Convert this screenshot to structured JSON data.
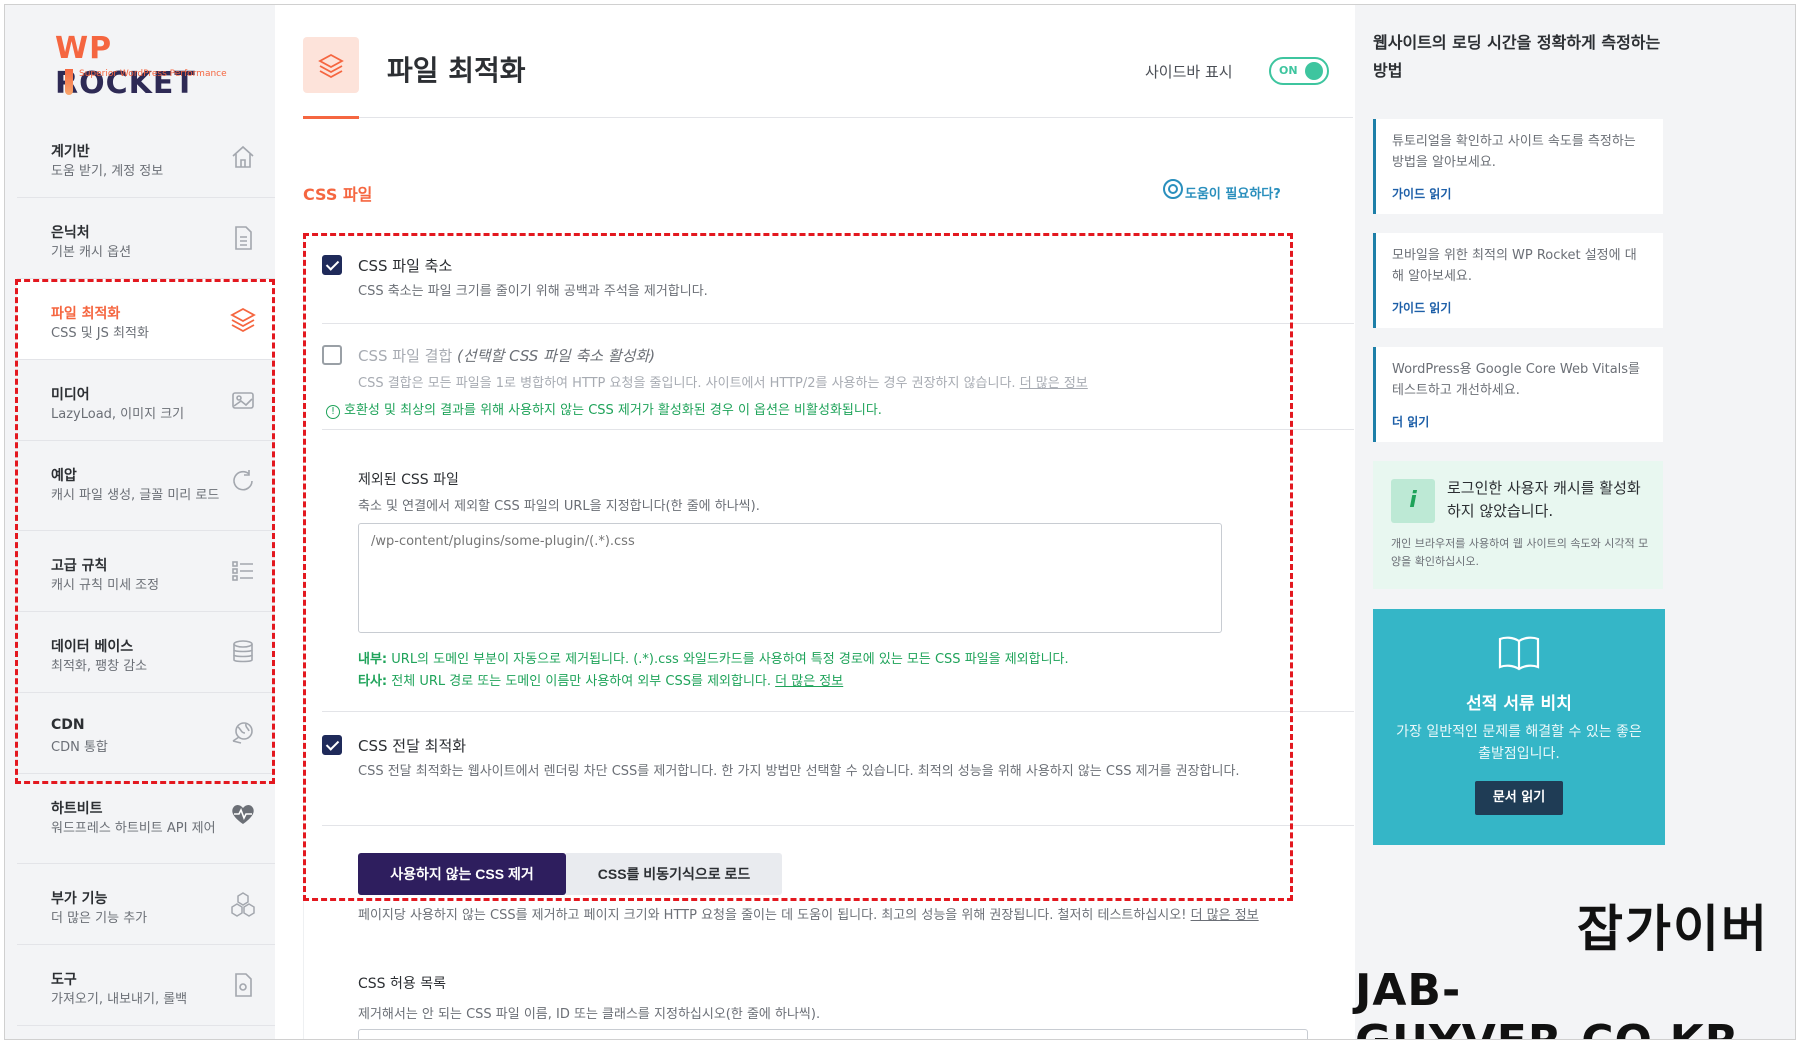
{
  "logo": {
    "brand_a": "WP",
    "brand_b": "ROCKET",
    "tagline": "Superior WordPress Performance"
  },
  "sidebar": {
    "items": [
      {
        "title": "계기반",
        "subtitle": "도움 받기, 계정 정보",
        "icon": "home-icon"
      },
      {
        "title": "은닉처",
        "subtitle": "기본 캐시 옵션",
        "icon": "file-icon"
      },
      {
        "title": "파일 최적화",
        "subtitle": "CSS 및 JS 최적화",
        "icon": "layers-icon",
        "active": true
      },
      {
        "title": "미디어",
        "subtitle": "LazyLoad, 이미지 크기",
        "icon": "image-icon"
      },
      {
        "title": "예압",
        "subtitle": "캐시 파일 생성, 글꼴 미리 로드",
        "icon": "refresh-icon"
      },
      {
        "title": "고급 규칙",
        "subtitle": "캐시 규칙 미세 조정",
        "icon": "list-icon"
      },
      {
        "title": "데이터 베이스",
        "subtitle": "최적화, 팽창 감소",
        "icon": "database-icon"
      },
      {
        "title": "CDN",
        "subtitle": "CDN 통합",
        "icon": "globe-icon"
      },
      {
        "title": "하트비트",
        "subtitle": "워드프레스 하트비트 API 제어",
        "icon": "heart-icon"
      },
      {
        "title": "부가 기능",
        "subtitle": "더 많은 기능 추가",
        "icon": "cubes-icon"
      },
      {
        "title": "도구",
        "subtitle": "가져오기, 내보내기, 롤백",
        "icon": "tool-icon"
      }
    ]
  },
  "header": {
    "title": "파일 최적화",
    "sidebar_toggle_label": "사이드바 표시",
    "toggle_state": "ON"
  },
  "section": {
    "title": "CSS 파일",
    "help": "도움이 필요하다?"
  },
  "options": {
    "minify": {
      "title": "CSS 파일 축소",
      "desc": "CSS 축소는 파일 크기를 줄이기 위해 공백과 주석을 제거합니다.",
      "checked": true
    },
    "combine": {
      "title": "CSS 파일 결합",
      "title_note": "(선택할 CSS 파일 축소 활성화)",
      "desc": "CSS 결합은 모든 파일을 1로 병합하여 HTTP 요청을 줄입니다. 사이트에서 HTTP/2를 사용하는 경우 권장하지 않습니다.",
      "desc_link": "더 많은 정보",
      "warning": "호환성 및 최상의 결과를 위해 사용하지 않는 CSS 제거가 활성화된 경우 이 옵션은 비활성화됩니다.",
      "checked": false
    },
    "excluded": {
      "label": "제외된 CSS 파일",
      "desc": "축소 및 연결에서 제외할 CSS 파일의 URL을 지정합니다(한 줄에 하나씩).",
      "placeholder": "/wp-content/plugins/some-plugin/(.*).css",
      "note_internal_label": "내부:",
      "note_internal": "URL의 도메인 부분이 자동으로 제거됩니다. (.*).css 와일드카드를 사용하여 특정 경로에 있는 모든 CSS 파일을 제외합니다.",
      "note_external_label": "타사:",
      "note_external": "전체 URL 경로 또는 도메인 이름만 사용하여 외부 CSS를 제외합니다.",
      "note_external_link": "더 많은 정보"
    },
    "delivery": {
      "title": "CSS 전달 최적화",
      "desc": "CSS 전달 최적화는 웹사이트에서 렌더링 차단 CSS를 제거합니다. 한 가지 방법만 선택할 수 있습니다. 최적의 성능을 위해 사용하지 않는 CSS 제거를 권장합니다.",
      "checked": true,
      "btn_remove": "사용하지 않는 CSS 제거",
      "btn_async": "CSS를 비동기식으로 로드",
      "after_desc": "페이지당 사용하지 않는 CSS를 제거하고 페이지 크기와 HTTP 요청을 줄이는 데 도움이 됩니다. 최고의 성능을 위해 권장됩니다. 철저히 테스트하십시오!",
      "after_link": "더 많은 정보",
      "allow_label": "CSS 허용 목록",
      "allow_desc": "제거해서는 안 되는 CSS 파일 이름, ID 또는 클래스를 지정하십시오(한 줄에 하나씩)."
    }
  },
  "rail": {
    "title": "웹사이트의 로딩 시간을 정확하게 측정하는 방법",
    "cards": [
      {
        "text": "튜토리얼을 확인하고 사이트 속도를 측정하는 방법을 알아보세요.",
        "link": "가이드 읽기"
      },
      {
        "text": "모바일을 위한 최적의 WP Rocket 설정에 대해 알아보세요.",
        "link": "가이드 읽기"
      },
      {
        "text": "WordPress용 Google Core Web Vitals를 테스트하고 개선하세요.",
        "link": "더 읽기"
      }
    ],
    "info": {
      "icon_glyph": "i",
      "title": "로그인한 사용자 캐시를 활성화하지 않았습니다.",
      "text": "개인 브라우저를 사용하여 웹 사이트의 속도와 시각적 모양을 확인하십시오."
    },
    "docs": {
      "title": "선적 서류 비치",
      "text": "가장 일반적인 문제를 해결할 수 있는 좋은 출발점입니다.",
      "button": "문서 읽기"
    }
  },
  "watermark": {
    "korean": "잡가이버",
    "latin": "JAB-GUYVER.CO.KR"
  },
  "colors": {
    "accent": "#f56640",
    "navy": "#2e1e5e",
    "teal": "#35b6c7",
    "green": "#1fa35a",
    "dash": "#e3181f"
  }
}
